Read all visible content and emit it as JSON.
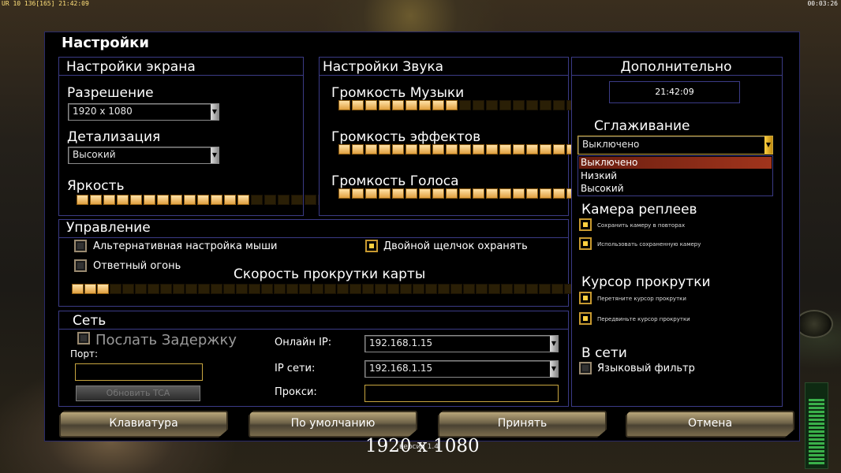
{
  "hud": {
    "top_left": "UR 10 136[165] 21:42:09",
    "top_right": "00:03:26"
  },
  "dialog": {
    "title": "Настройки"
  },
  "screen": {
    "title": "Настройки экрана",
    "resolution_label": "Разрешение",
    "resolution_value": "1920 x 1080",
    "detail_label": "Детализация",
    "detail_value": "Высокий",
    "brightness_label": "Яркость",
    "brightness_level": 13,
    "brightness_total": 20
  },
  "sound": {
    "title": "Настройки Звука",
    "music_label": "Громкость Музыки",
    "music_level": 9,
    "effects_label": "Громкость эффектов",
    "effects_level": 20,
    "voice_label": "Громкость Голоса",
    "voice_level": 20,
    "total": 20
  },
  "controls": {
    "title": "Управление",
    "alt_mouse": "Альтернативная настройка мыши",
    "double_click": "Двойной щелчок охранять",
    "return_fire": "Ответный огонь",
    "scroll_speed_label": "Скорость прокрутки карты",
    "scroll_level": 3,
    "scroll_total": 40
  },
  "network": {
    "title": "Сеть",
    "send_delay": "Послать Задержку",
    "port_label": "Порт:",
    "port_value": "",
    "update_button": "Обновить TCA",
    "online_ip_label": "Онлайн IP:",
    "online_ip_value": "192.168.1.15",
    "lan_ip_label": "IP сети:",
    "lan_ip_value": "192.168.1.15",
    "proxy_label": "Прокси:",
    "proxy_value": ""
  },
  "extra": {
    "title": "Дополнительно",
    "time": "21:42:09",
    "antialias_label": "Сглаживание",
    "antialias_value": "Выключено",
    "antialias_options": [
      "Выключено",
      "Низкий",
      "Высокий"
    ],
    "replay_camera_title": "Камера реплеев",
    "replay_save": "Сохранить камеру в повторах",
    "replay_use": "Использовать сохраненную камеру",
    "scroll_cursor_title": "Курсор прокрутки",
    "cursor_drag": "Перетяните курсор прокрутки",
    "cursor_move": "Передвиньте курсор прокрутки",
    "online_title": "В сети",
    "language_filter": "Языковый фильтр"
  },
  "buttons": {
    "keyboard": "Клавиатура",
    "defaults": "По умолчанию",
    "accept": "Принять",
    "cancel": "Отмена"
  },
  "footer": {
    "version": "версия 1.4",
    "resolution_overlay": "1920 x 1080"
  }
}
